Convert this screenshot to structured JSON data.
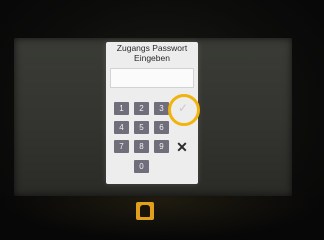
{
  "dialog": {
    "title_line1": "Zugangs Passwort",
    "title_line2": "Eingeben",
    "password_value": ""
  },
  "keypad": {
    "keys": [
      "1",
      "2",
      "3",
      "4",
      "5",
      "6",
      "7",
      "8",
      "9",
      "0"
    ],
    "ok_symbol": "✓",
    "cancel_symbol": "✕"
  },
  "colors": {
    "highlight": "#f0b40d",
    "key_bg": "#6f6e7a"
  }
}
